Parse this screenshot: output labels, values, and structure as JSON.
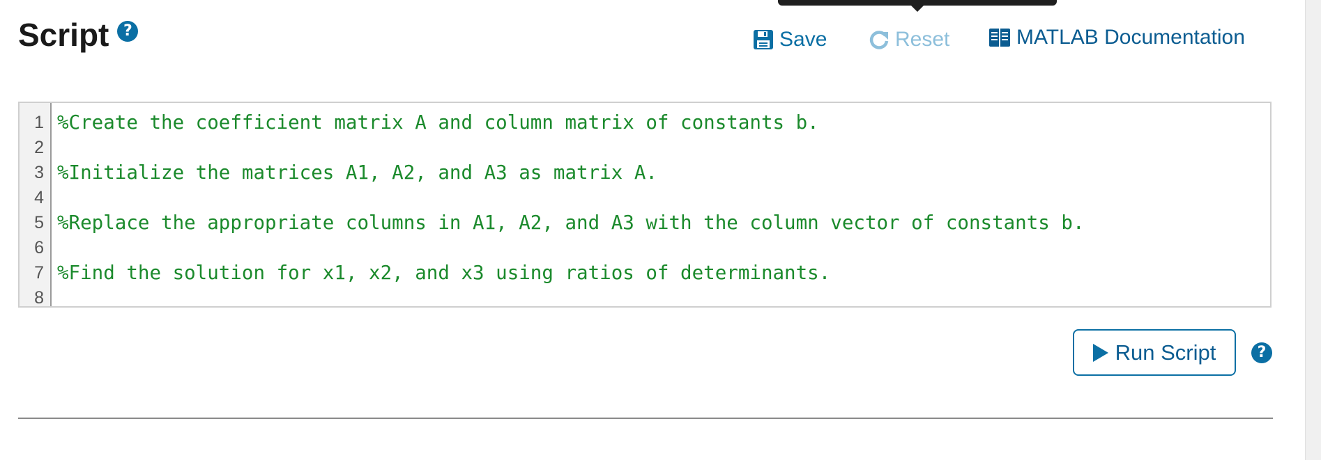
{
  "header": {
    "title": "Script",
    "help_icon": "question-circle-icon"
  },
  "toolbar": {
    "save_label": "Save",
    "save_icon": "floppy-disk-icon",
    "reset_label": "Reset",
    "reset_icon": "refresh-icon",
    "doc_label": "MATLAB Documentation",
    "doc_icon": "book-icon"
  },
  "editor": {
    "line_numbers": [
      "1",
      "2",
      "3",
      "4",
      "5",
      "6",
      "7",
      "8"
    ],
    "lines": [
      "%Create the coefficient matrix A and column matrix of constants b.",
      "",
      "%Initialize the matrices A1, A2, and A3 as matrix A.",
      "",
      "%Replace the appropriate columns in A1, A2, and A3 with the column vector of constants b.",
      "",
      "%Find the solution for x1, x2, and x3 using ratios of determinants.",
      ""
    ]
  },
  "run": {
    "label": "Run Script",
    "icon": "play-icon",
    "help_icon": "question-circle-icon"
  },
  "colors": {
    "accent": "#0b6fa4",
    "comment": "#1b8a2c",
    "disabled": "#8dbfdb"
  }
}
